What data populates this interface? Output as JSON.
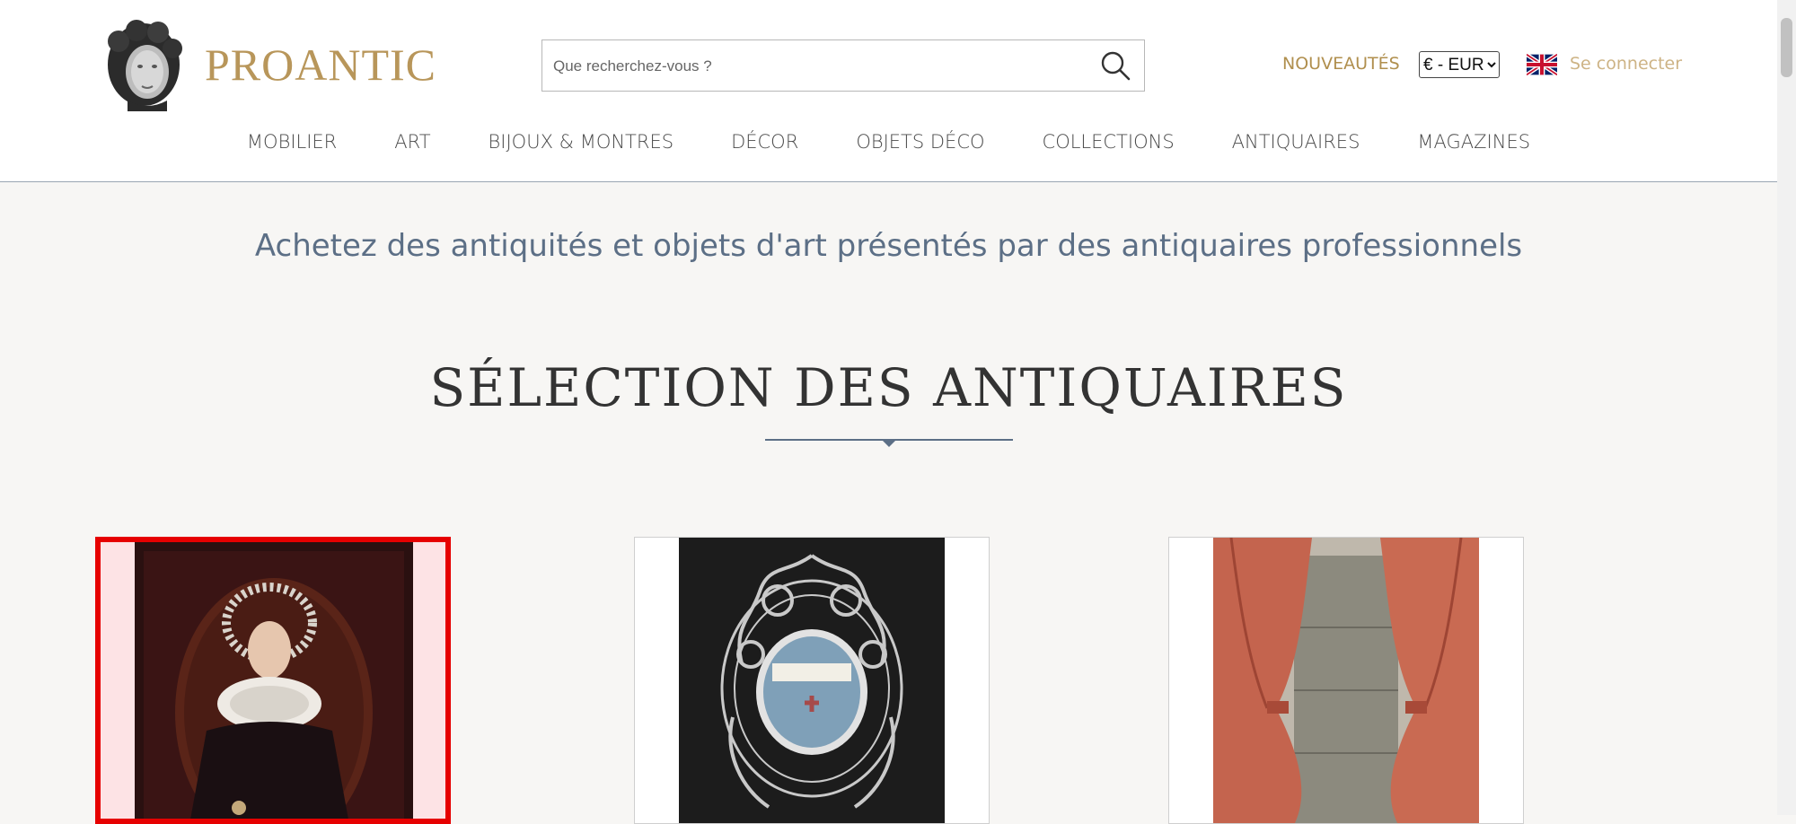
{
  "header": {
    "logo_text": "PROANTIC",
    "search_placeholder": "Que recherchez-vous ?",
    "new_link": "NOUVEAUTÉS",
    "currency_selected": "€ - EUR",
    "login_link": "Se connecter",
    "brand_color": "#b8965a"
  },
  "nav": {
    "items": [
      "MOBILIER",
      "ART",
      "BIJOUX & MONTRES",
      "DÉCOR",
      "OBJETS DÉCO",
      "COLLECTIONS",
      "ANTIQUAIRES",
      "MAGAZINES"
    ]
  },
  "main": {
    "tagline": "Achetez des antiquités et objets d'art présentés par des antiquaires professionnels",
    "section_title": "SÉLECTION DES ANTIQUAIRES",
    "cards": [
      {
        "subject": "portrait-painting",
        "selected": true
      },
      {
        "subject": "silver-filigree-reliquary",
        "selected": false
      },
      {
        "subject": "velvet-curtains",
        "selected": false
      }
    ]
  }
}
